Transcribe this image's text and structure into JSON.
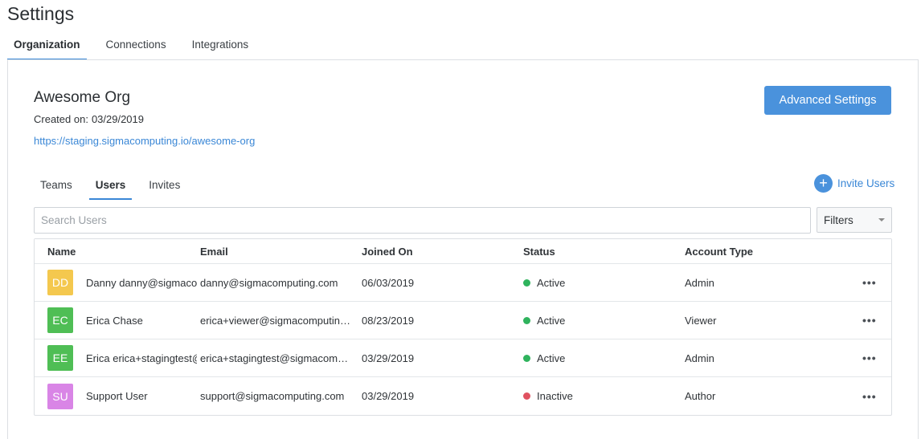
{
  "page": {
    "title": "Settings"
  },
  "top_tabs": [
    {
      "label": "Organization",
      "active": true
    },
    {
      "label": "Connections",
      "active": false
    },
    {
      "label": "Integrations",
      "active": false
    }
  ],
  "org": {
    "name": "Awesome Org",
    "created_label": "Created on:",
    "created_date": "03/29/2019",
    "url": "https://staging.sigmacomputing.io/awesome-org",
    "advanced_button": "Advanced Settings"
  },
  "sub_tabs": [
    {
      "label": "Teams",
      "active": false
    },
    {
      "label": "Users",
      "active": true
    },
    {
      "label": "Invites",
      "active": false
    }
  ],
  "invite": {
    "label": "Invite Users",
    "icon": "plus-icon"
  },
  "search": {
    "placeholder": "Search Users",
    "value": ""
  },
  "filters": {
    "label": "Filters",
    "icon": "chevron-down-icon"
  },
  "table": {
    "headers": {
      "name": "Name",
      "email": "Email",
      "joined": "Joined On",
      "status": "Status",
      "type": "Account Type"
    },
    "rows": [
      {
        "initials": "DD",
        "avatar_color": "#f4c84e",
        "name": "Danny danny@sigmacomputing.com",
        "email": "danny@sigmacomputing.com",
        "joined": "06/03/2019",
        "status": "Active",
        "status_color": "#2fb35d",
        "type": "Admin",
        "more": "•••"
      },
      {
        "initials": "EC",
        "avatar_color": "#4fbe55",
        "name": "Erica Chase",
        "email": "erica+viewer@sigmacomputing.com",
        "joined": "08/23/2019",
        "status": "Active",
        "status_color": "#2fb35d",
        "type": "Viewer",
        "more": "•••"
      },
      {
        "initials": "EE",
        "avatar_color": "#4fbe55",
        "name": "Erica erica+stagingtest@sigmacomputing.com",
        "email": "erica+stagingtest@sigmacomputing.com",
        "joined": "03/29/2019",
        "status": "Active",
        "status_color": "#2fb35d",
        "type": "Admin",
        "more": "•••"
      },
      {
        "initials": "SU",
        "avatar_color": "#d985e6",
        "name": "Support User",
        "email": "support@sigmacomputing.com",
        "joined": "03/29/2019",
        "status": "Inactive",
        "status_color": "#e05260",
        "type": "Author",
        "more": "•••"
      }
    ]
  }
}
